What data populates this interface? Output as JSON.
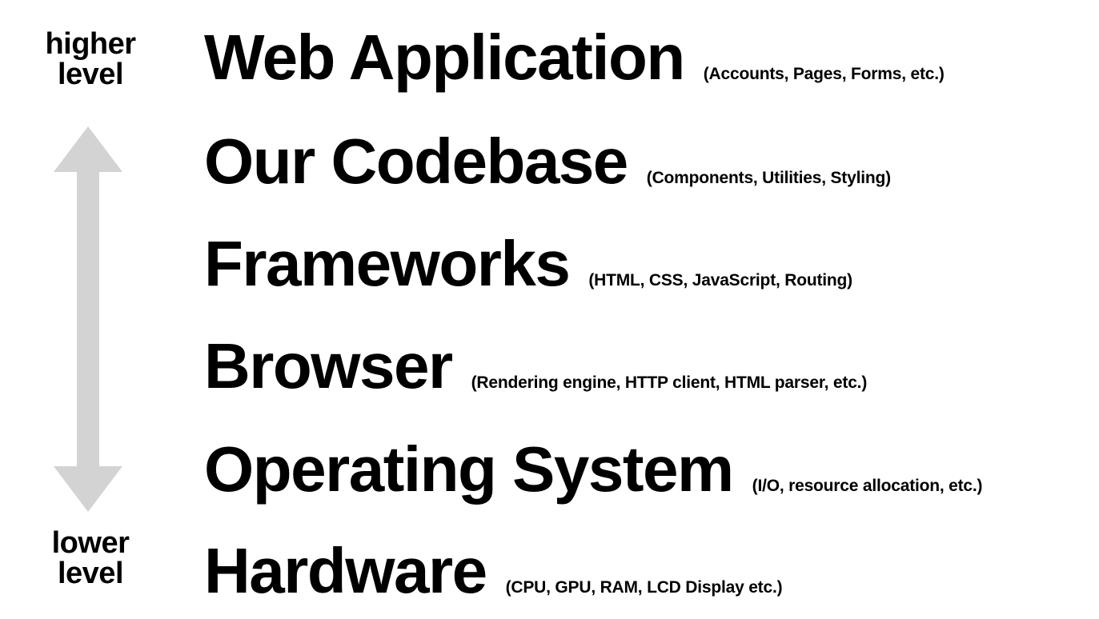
{
  "axis": {
    "top_label": [
      "higher",
      "level"
    ],
    "bottom_label": [
      "lower",
      "level"
    ],
    "arrow_color": "#d3d3d3"
  },
  "layers": [
    {
      "name": "Web Application",
      "detail": "(Accounts, Pages, Forms, etc.)"
    },
    {
      "name": "Our Codebase",
      "detail": "(Components, Utilities, Styling)"
    },
    {
      "name": "Frameworks",
      "detail": "(HTML, CSS, JavaScript, Routing)"
    },
    {
      "name": "Browser",
      "detail": "(Rendering engine, HTTP client, HTML parser, etc.)"
    },
    {
      "name": "Operating System",
      "detail": "(I/O, resource allocation, etc.)"
    },
    {
      "name": "Hardware",
      "detail": "(CPU, GPU, RAM, LCD Display etc.)"
    }
  ]
}
